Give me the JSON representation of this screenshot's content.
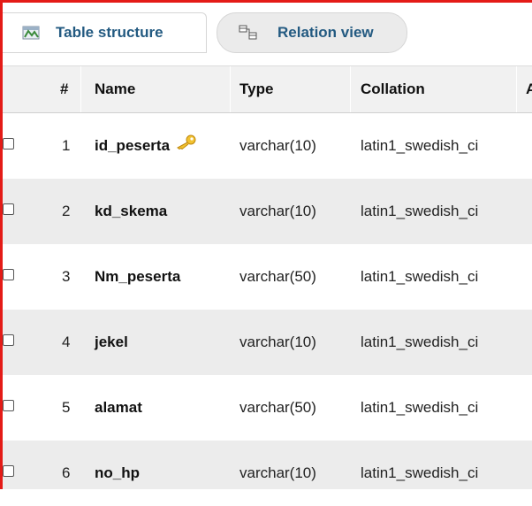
{
  "tabs": {
    "structure_label": "Table structure",
    "relation_label": "Relation view"
  },
  "table": {
    "headers": {
      "num": "#",
      "name": "Name",
      "type": "Type",
      "collation": "Collation",
      "extra": "A"
    },
    "rows": [
      {
        "num": "1",
        "name": "id_peserta",
        "type": "varchar(10)",
        "collation": "latin1_swedish_ci",
        "primary_key": true
      },
      {
        "num": "2",
        "name": "kd_skema",
        "type": "varchar(10)",
        "collation": "latin1_swedish_ci"
      },
      {
        "num": "3",
        "name": "Nm_peserta",
        "type": "varchar(50)",
        "collation": "latin1_swedish_ci"
      },
      {
        "num": "4",
        "name": "jekel",
        "type": "varchar(10)",
        "collation": "latin1_swedish_ci"
      },
      {
        "num": "5",
        "name": "alamat",
        "type": "varchar(50)",
        "collation": "latin1_swedish_ci"
      },
      {
        "num": "6",
        "name": "no_hp",
        "type": "varchar(10)",
        "collation": "latin1_swedish_ci"
      }
    ]
  },
  "icons": {
    "structure": "table-structure-icon",
    "relation": "relation-view-icon",
    "key": "primary-key-icon"
  },
  "colors": {
    "accent": "#235a81",
    "highlight_border": "#e41b17",
    "key": "#e8b020"
  }
}
